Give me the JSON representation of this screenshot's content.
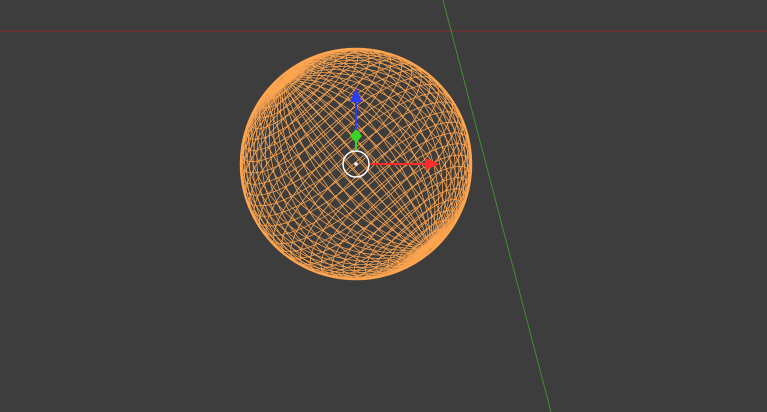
{
  "viewport": {
    "mode": "wireframe",
    "background_color": "#3d3d3d"
  },
  "axes": {
    "x_axis_color": "#8b2a2a",
    "y_axis_color": "#3f8f2f"
  },
  "object": {
    "type": "uv-sphere",
    "wire_color": "#ffa54f",
    "selected": true
  },
  "gizmo": {
    "type": "translate",
    "x_color": "#ff2a2a",
    "y_color": "#37d626",
    "z_color": "#2a3cff",
    "pivot_color": "#ffffff",
    "icons": [
      "move-x-arrow-icon",
      "move-y-handle-icon",
      "move-z-arrow-icon",
      "pivot-circle-icon"
    ]
  }
}
